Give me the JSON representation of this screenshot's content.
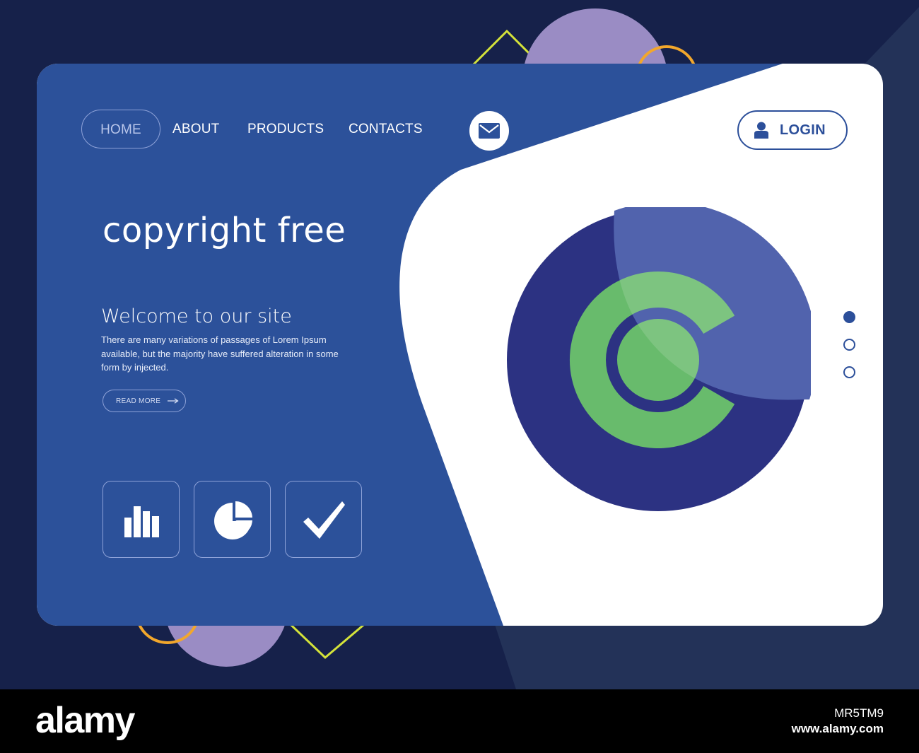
{
  "colors": {
    "page_background": "#16214a",
    "panel_blue": "#2c519a",
    "card_white": "#ffffff",
    "accent_navy": "#2c3282",
    "accent_green": "#68bb6c",
    "accent_lavender": "#9a8cc4",
    "accent_orange": "#f2a72c",
    "accent_yellow": "#d4e33a"
  },
  "nav": {
    "items": [
      {
        "label": "HOME",
        "active": true
      },
      {
        "label": "ABOUT",
        "active": false
      },
      {
        "label": "PRODUCTS",
        "active": false
      },
      {
        "label": "CONTACTS",
        "active": false
      }
    ],
    "mail_icon": "envelope-icon"
  },
  "login": {
    "label": "LOGIN",
    "icon": "user-icon"
  },
  "hero": {
    "title": "copyright free",
    "welcome": "Welcome to our site",
    "description": "There are many variations of passages of Lorem Ipsum available, but the majority have suffered alteration in some form by injected.",
    "read_more": "READ MORE"
  },
  "feature_icons": [
    "bar-chart-icon",
    "pie-chart-icon",
    "checkmark-icon"
  ],
  "slider": {
    "total": 3,
    "active_index": 0
  },
  "illustration": "copyright-symbol-icon",
  "footer": {
    "brand": "alamy",
    "image_id": "MR5TM9",
    "url": "www.alamy.com"
  }
}
